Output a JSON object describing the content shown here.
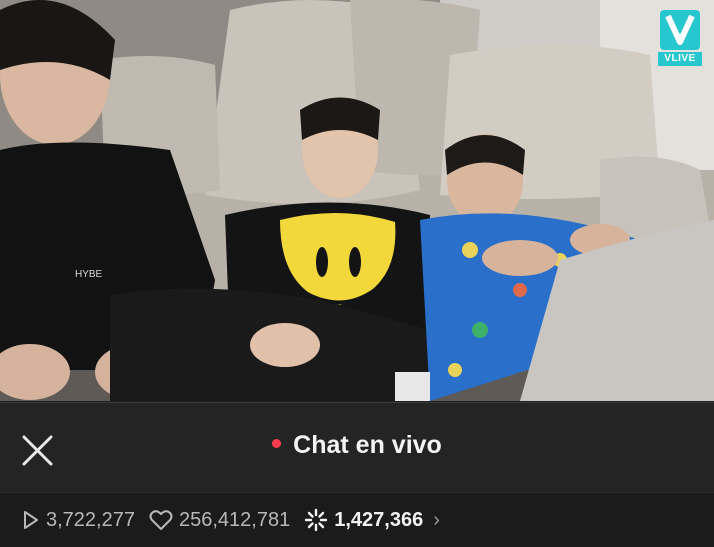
{
  "video": {
    "logo_text": "VLIVE",
    "shirt_text": "HYBE",
    "accent": "#27c7cf"
  },
  "chat": {
    "title": "Chat en vivo",
    "live_dot_color": "#ff3b4e",
    "close_icon": "close-icon"
  },
  "stats": {
    "plays": "3,722,277",
    "likes": "256,412,781",
    "viewers": "1,427,366"
  }
}
